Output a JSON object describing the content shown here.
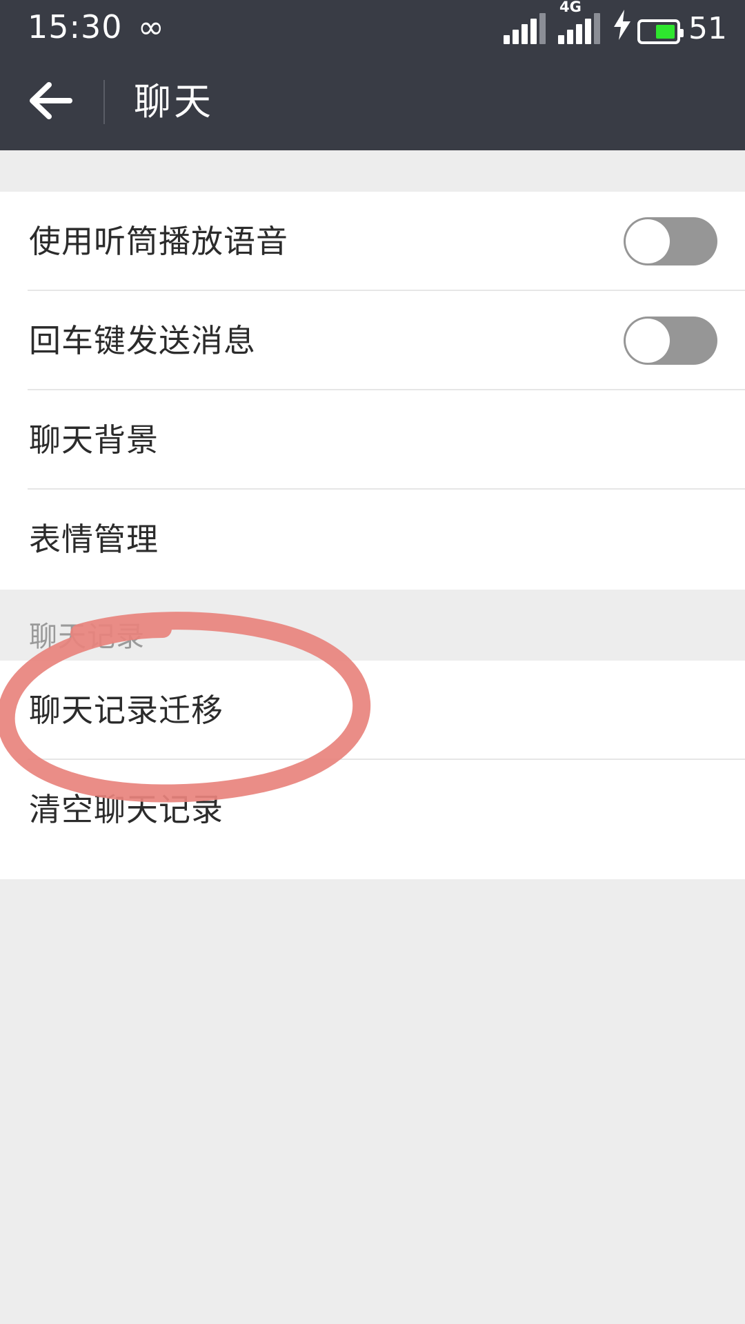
{
  "status_bar": {
    "time": "15:30",
    "infinity_icon": "infinity-icon",
    "network_label": "4G",
    "charging_icon": "lightning-bolt-icon",
    "battery_percent": "51",
    "battery_level": 58,
    "colors": {
      "background": "#393c45",
      "text": "#ffffff",
      "battery_fill": "#2ee62e"
    }
  },
  "title_bar": {
    "back_icon": "back-arrow-icon",
    "title": "聊天",
    "colors": {
      "background": "#393c45",
      "text": "#ffffff"
    }
  },
  "sections": [
    {
      "header": "",
      "items": [
        {
          "label": "使用听筒播放语音",
          "type": "toggle",
          "value": "off"
        },
        {
          "label": "回车键发送消息",
          "type": "toggle",
          "value": "off"
        },
        {
          "label": "聊天背景",
          "type": "link"
        },
        {
          "label": "表情管理",
          "type": "link"
        }
      ]
    },
    {
      "header": "聊天记录",
      "items": [
        {
          "label": "聊天记录迁移",
          "type": "link"
        },
        {
          "label": "清空聊天记录",
          "type": "link"
        }
      ]
    }
  ],
  "annotation": {
    "shape": "hand-drawn-ellipse",
    "target_label": "聊天记录迁移",
    "color": "#e8837d"
  },
  "colors": {
    "page_background": "#ededed",
    "card_background": "#ffffff",
    "primary_text": "#2b2b2b",
    "secondary_text": "#9a9a9a",
    "divider": "#e6e6e6",
    "toggle_track_off": "#969696",
    "toggle_knob": "#ffffff"
  }
}
